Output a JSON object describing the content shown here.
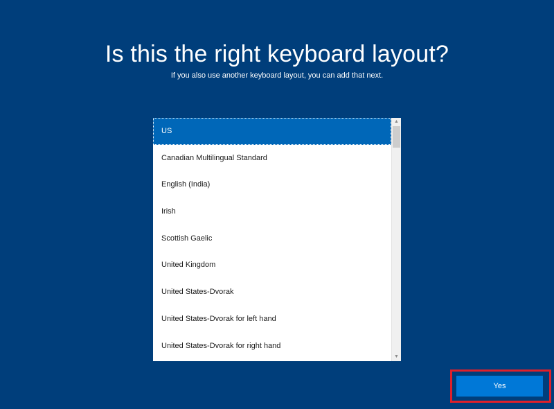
{
  "header": {
    "title": "Is this the right keyboard layout?",
    "subtitle": "If you also use another keyboard layout, you can add that next."
  },
  "keyboard_list": {
    "selected_index": 0,
    "items": [
      {
        "label": "US"
      },
      {
        "label": "Canadian Multilingual Standard"
      },
      {
        "label": "English (India)"
      },
      {
        "label": "Irish"
      },
      {
        "label": "Scottish Gaelic"
      },
      {
        "label": "United Kingdom"
      },
      {
        "label": "United States-Dvorak"
      },
      {
        "label": "United States-Dvorak for left hand"
      },
      {
        "label": "United States-Dvorak for right hand"
      }
    ],
    "scrollbar": {
      "up_arrow_icon": "chevron-up-icon",
      "down_arrow_icon": "chevron-down-icon"
    }
  },
  "actions": {
    "yes_label": "Yes"
  },
  "colors": {
    "background": "#003e7b",
    "selected_item": "#0067b8",
    "primary_button": "#0078d7",
    "highlight_box": "#e0202a"
  }
}
